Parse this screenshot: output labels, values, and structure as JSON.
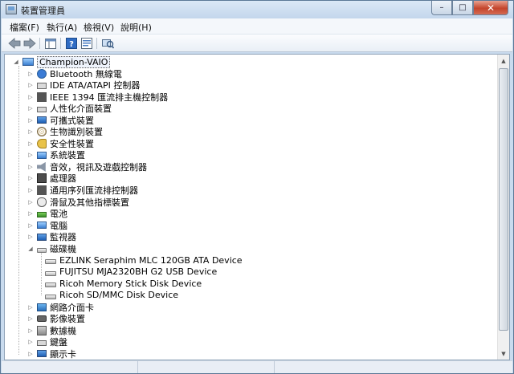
{
  "window": {
    "title": "裝置管理員",
    "caption": {
      "minimize": "–",
      "maximize": "□",
      "close": "✕"
    }
  },
  "menu": [
    "檔案(F)",
    "執行(A)",
    "檢視(V)",
    "說明(H)"
  ],
  "toolbar": {
    "back_icon": "arrow-left",
    "forward_icon": "arrow-right",
    "properties_icon": "properties",
    "help_icon": "help",
    "console_icon": "console-tree",
    "scan_icon": "scan-hardware"
  },
  "tree": {
    "root": "Champion-VAIO",
    "categories": [
      {
        "label": "Bluetooth 無線電",
        "icon": "bluetooth-icon"
      },
      {
        "label": "IDE ATA/ATAPI 控制器",
        "icon": "ide-controller-icon"
      },
      {
        "label": "IEEE 1394 匯流排主機控制器",
        "icon": "ieee1394-icon"
      },
      {
        "label": "人性化介面裝置",
        "icon": "hid-icon"
      },
      {
        "label": "可攜式裝置",
        "icon": "portable-device-icon"
      },
      {
        "label": "生物識別裝置",
        "icon": "fingerprint-icon"
      },
      {
        "label": "安全性裝置",
        "icon": "key-icon"
      },
      {
        "label": "系統裝置",
        "icon": "system-device-icon"
      },
      {
        "label": "音效，視訊及遊戲控制器",
        "icon": "speaker-icon"
      },
      {
        "label": "處理器",
        "icon": "processor-icon"
      },
      {
        "label": "通用序列匯流排控制器",
        "icon": "usb-icon"
      },
      {
        "label": "滑鼠及其他指標裝置",
        "icon": "mouse-icon"
      },
      {
        "label": "電池",
        "icon": "battery-icon"
      },
      {
        "label": "電腦",
        "icon": "computer-icon"
      },
      {
        "label": "監視器",
        "icon": "monitor-icon"
      },
      {
        "label": "磁碟機",
        "icon": "disk-drive-icon",
        "expanded": true,
        "children": [
          "EZLINK Seraphim MLC 120GB ATA Device",
          "FUJITSU MJA2320BH G2 USB Device",
          "Ricoh Memory Stick Disk Device",
          "Ricoh SD/MMC Disk Device"
        ]
      },
      {
        "label": "網路介面卡",
        "icon": "network-adapter-icon"
      },
      {
        "label": "影像裝置",
        "icon": "camera-icon"
      },
      {
        "label": "數據機",
        "icon": "modem-icon"
      },
      {
        "label": "鍵盤",
        "icon": "keyboard-icon"
      },
      {
        "label": "顯示卡",
        "icon": "display-adapter-icon"
      }
    ]
  }
}
